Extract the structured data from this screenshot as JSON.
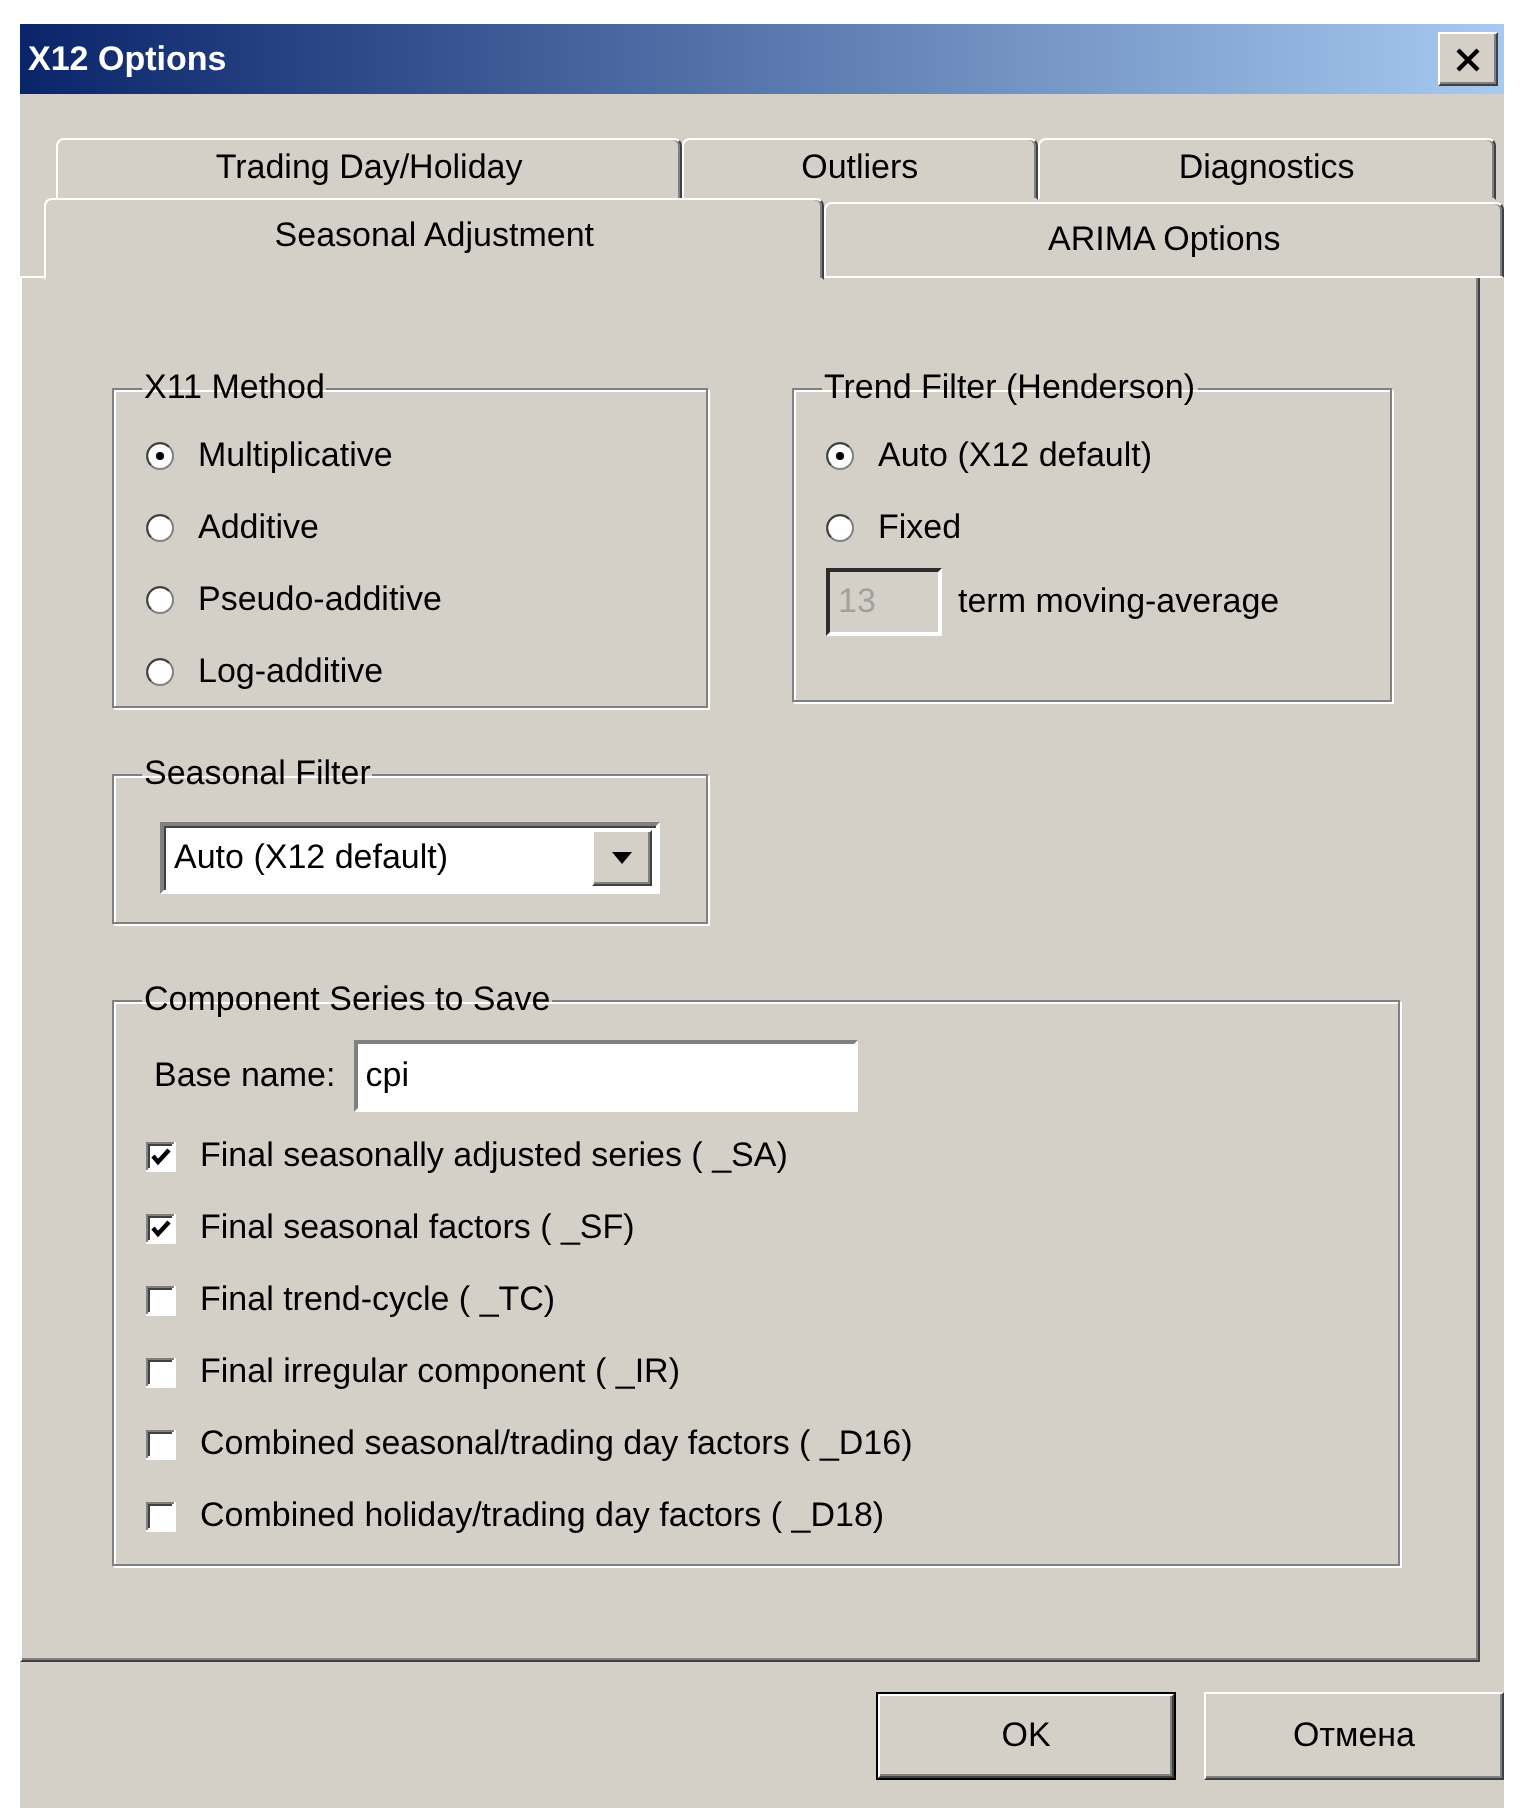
{
  "window": {
    "title": "X12 Options"
  },
  "tab_rows": [
    [
      {
        "label": "Trading Day/Holiday",
        "selected": false
      },
      {
        "label": "Outliers",
        "selected": false
      },
      {
        "label": "Diagnostics",
        "selected": false
      }
    ],
    [
      {
        "label": "Seasonal Adjustment",
        "selected": true
      },
      {
        "label": "ARIMA Options",
        "selected": false
      }
    ]
  ],
  "x11_method": {
    "title": "X11 Method",
    "options": [
      {
        "label": "Multiplicative",
        "selected": true
      },
      {
        "label": "Additive",
        "selected": false
      },
      {
        "label": "Pseudo-additive",
        "selected": false
      },
      {
        "label": "Log-additive",
        "selected": false
      }
    ]
  },
  "trend_filter": {
    "title": "Trend Filter (Henderson)",
    "options": [
      {
        "label": "Auto (X12 default)",
        "selected": true
      },
      {
        "label": "Fixed",
        "selected": false
      }
    ],
    "term": {
      "value": "13",
      "disabled": true,
      "label": "term moving-average"
    }
  },
  "seasonal_filter": {
    "title": "Seasonal Filter",
    "value": "Auto (X12 default)"
  },
  "component_series": {
    "title": "Component Series to Save",
    "base_name_label": "Base name:",
    "base_name": "cpi",
    "items": [
      {
        "label": "Final seasonally adjusted series ( _SA)",
        "checked": true
      },
      {
        "label": "Final seasonal factors ( _SF)",
        "checked": true
      },
      {
        "label": "Final trend-cycle ( _TC)",
        "checked": false
      },
      {
        "label": "Final irregular component ( _IR)",
        "checked": false
      },
      {
        "label": "Combined seasonal/trading day factors ( _D16)",
        "checked": false
      },
      {
        "label": "Combined holiday/trading day factors ( _D18)",
        "checked": false
      }
    ]
  },
  "buttons": [
    {
      "label": "OK",
      "default": true
    },
    {
      "label": "Отмена",
      "default": false
    }
  ]
}
